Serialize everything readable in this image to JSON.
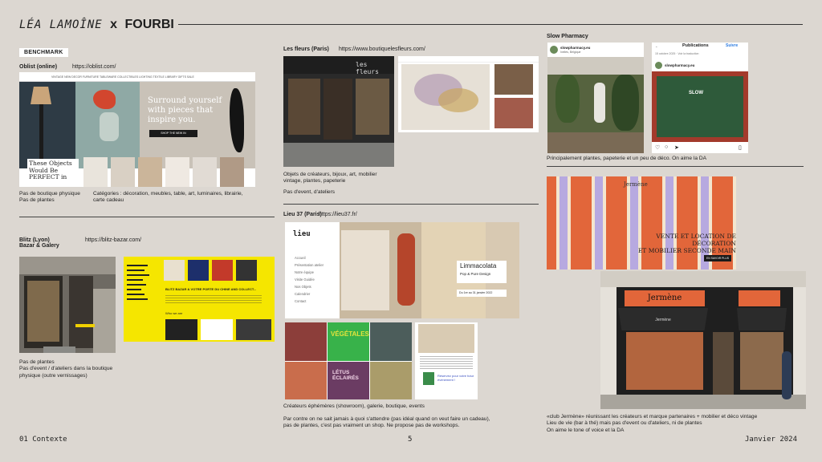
{
  "header": {
    "brand_name": "LÉA LAMOÎNE",
    "brand_x": "x",
    "brand_partner": "FOURBI"
  },
  "benchmark_label": "BENCHMARK",
  "oblist": {
    "title": "Oblist (online)",
    "url": "https://oblist.com/",
    "shot": {
      "nav": "VINTAGE  NEW  DECOR  FURNITURE  TABLEWARE  COLLECTIBLES  LIGHTING  TEXTILE  LIBRARY  GIFTS  SALE",
      "hero_text": "Surround yourself with pieces that inspire you.",
      "cta": "SHOP THE NEW IN",
      "card_text": "These Objects Would Be PERFECT in"
    },
    "caption_left": [
      "Pas de boutique physique",
      "Pas de plantes"
    ],
    "caption_right": "Catégories : décoration, meubles, table, art, luminaires, librairie, carte cadeau"
  },
  "blitz": {
    "title_line1": "Blitz (Lyon)",
    "title_line2": "Bazar & Galery",
    "url": "https://blitz-bazar.com/",
    "shot": {
      "headline": "BLITZ BAZAR & VOTRE PORTE DU CHINE AND COLLECT...",
      "subhead": "Who we are"
    },
    "caption": [
      "Pas de plantes",
      "Pas d'event / d'ateliers dans la boutique physique (outre vernissages)"
    ]
  },
  "fleurs": {
    "title": "Les fleurs (Paris)",
    "url": "https://www.boutiquelesfleurs.com/",
    "sign": "les fleurs",
    "caption1": [
      "Objets de créateurs, bijoux, art, mobilier",
      "vintage, plantes, papeterie"
    ],
    "caption2": "Pas d'event, d'ateliers"
  },
  "lieu37": {
    "title": "Lieu 37 (Paris)",
    "url": "https://lieu37.fr/",
    "logo": "lieu",
    "menu": [
      "Accueil",
      "Présentation atelier",
      "Notre équipe",
      "Visite Guidée",
      "Nos Objets",
      "Calendrier",
      "Contact"
    ],
    "banner_title": "Limmacolata",
    "banner_sub": "Pop & Pure Design",
    "banner_date": "Du 1er au 31 janvier 2022",
    "tile1": "VÉGÉTALES",
    "tile2": "LÉTUS ÉCLAIRÉS",
    "phone_cta": "Réservez pour votre futur événement !",
    "caption1": "Créateurs éphémères (showroom), galerie, boutique, events",
    "caption2": "Par contre on ne sait jamais à quoi s'attendre (pas idéal quand on veut faire un cadeau), pas de plantes, c'est pas vraiment un shop. Ne propose pas de workshops."
  },
  "slow": {
    "title": "Slow Pharmacy",
    "post_account": "slowpharmacy.eu",
    "post_location": "Ixelles, Belgique",
    "pub_header": "Publications",
    "pub_follow": "Suivre",
    "pub_account": "slowpharmacy.eu",
    "pub_meta": "15 octobre 2025 · Voir la traduction",
    "window_text": "SLOW",
    "caption": "Principalement plantes, papeterie et un peu de déco. On aime la DA"
  },
  "jermene": {
    "logo": "Jermène",
    "banner_text_line1": "VENTE ET LOCATION DE DÉCORATION",
    "banner_text_line2": "ET MOBILIER SECONDE MAIN",
    "banner_cta": "EN SAVOIR PLUS",
    "awning": "Jermène",
    "caption": [
      "«club Jermène» réunissant les créateurs et marque partenaires + mobilier et déco vintage",
      "Lieu de vie (bar à thé) mais pas d'event ou d'ateliers, ni de plantes",
      "On aime le tone of voice et la DA"
    ]
  },
  "footer": {
    "left": "01 Contexte",
    "page": "5",
    "right": "Janvier 2024"
  },
  "colors": {
    "background": "#dcd7d1",
    "blitz_yellow": "#f5e600",
    "jermene_orange": "#e2663a",
    "jermene_lilac": "#b7a9e0"
  }
}
